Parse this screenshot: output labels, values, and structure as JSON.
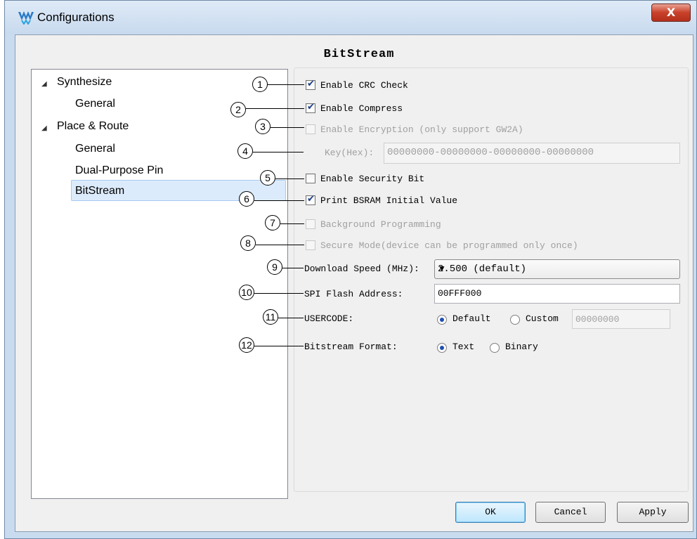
{
  "window": {
    "title": "Configurations",
    "close_symbol": "X"
  },
  "page_title": "BitStream",
  "tree": {
    "items": [
      {
        "label": "Synthesize",
        "expanded": true
      },
      {
        "label": "General"
      },
      {
        "label": "Place & Route",
        "expanded": true
      },
      {
        "label": "General"
      },
      {
        "label": "Dual-Purpose Pin"
      },
      {
        "label": "BitStream",
        "selected": true
      }
    ]
  },
  "options": {
    "crc": {
      "label": "Enable CRC Check",
      "checked": true,
      "marker": "1"
    },
    "compress": {
      "label": "Enable Compress",
      "checked": true,
      "marker": "2"
    },
    "encryption": {
      "label": "Enable Encryption (only support GW2A)",
      "checked": false,
      "disabled": true,
      "marker": "3"
    },
    "key": {
      "label": "Key(Hex):",
      "value": "00000000-00000000-00000000-00000000",
      "disabled": true,
      "marker": "4"
    },
    "security": {
      "label": "Enable Security Bit",
      "checked": false,
      "marker": "5"
    },
    "bsram": {
      "label": "Print BSRAM Initial Value",
      "checked": true,
      "marker": "6"
    },
    "background": {
      "label": "Background Programming",
      "checked": false,
      "disabled": true,
      "marker": "7"
    },
    "secure": {
      "label": "Secure Mode(device can be programmed only once)",
      "checked": false,
      "disabled": true,
      "marker": "8"
    },
    "speed": {
      "label": "Download Speed (MHz):",
      "value": "2.500 (default)",
      "marker": "9"
    },
    "spi": {
      "label": "SPI Flash Address:",
      "value": "00FFF000",
      "marker": "10"
    },
    "usercode": {
      "label": "USERCODE:",
      "opt_default": "Default",
      "opt_custom": "Custom",
      "selected": "Default",
      "custom_value": "00000000",
      "marker": "11"
    },
    "format": {
      "label": "Bitstream Format:",
      "opt_text": "Text",
      "opt_binary": "Binary",
      "selected": "Text",
      "marker": "12"
    }
  },
  "buttons": {
    "ok": "OK",
    "cancel": "Cancel",
    "apply": "Apply"
  },
  "icons": {
    "logo": "gowin-logo-icon",
    "dropdown": "chevron-down-icon",
    "expand": "triangle-expanded-icon"
  },
  "colors": {
    "titlebar": "#c8daee",
    "close": "#c9412a",
    "selection": "#dcebfc",
    "check": "#1e3f8a"
  }
}
